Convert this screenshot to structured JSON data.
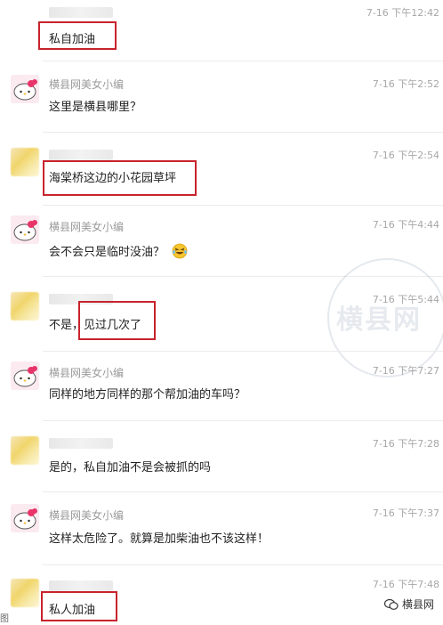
{
  "messages": [
    {
      "sender": "",
      "time": "7-16 下午12:42",
      "text": "私自加油",
      "avatar": "blurred"
    },
    {
      "sender": "横县网美女小编",
      "time": "7-16 下午2:52",
      "text": "这里是横县哪里？",
      "avatar": "kitty"
    },
    {
      "sender": "",
      "time": "7-16 下午2:54",
      "text": "海棠桥这边的小花园草坪",
      "avatar": "blurred"
    },
    {
      "sender": "横县网美女小编",
      "time": "7-16 下午4:44",
      "text": "会不会只是临时没油？",
      "avatar": "kitty",
      "emoji": "laughing-crying-emoji"
    },
    {
      "sender": "",
      "time": "7-16 下午5:44",
      "text_a": "不是，",
      "text_b": "见过几次了",
      "avatar": "blurred"
    },
    {
      "sender": "横县网美女小编",
      "time": "7-16 下午7:27",
      "text": "同样的地方同样的那个帮加油的车吗？",
      "avatar": "kitty"
    },
    {
      "sender": "",
      "time": "7-16 下午7:28",
      "text": "是的，私自加油不是会被抓的吗",
      "avatar": "blurred"
    },
    {
      "sender": "横县网美女小编",
      "time": "7-16 下午7:37",
      "text": "这样太危险了。就算是加柴油也不该这样！",
      "avatar": "kitty"
    },
    {
      "sender": "",
      "time": "7-16 下午7:48",
      "text": "私人加油",
      "avatar": "blurred"
    }
  ],
  "watermark": {
    "main": "横县网"
  },
  "brand": {
    "name": "横县网"
  },
  "bottom_left": "图",
  "colors": {
    "highlight": "#c8232c",
    "time": "#a7a7a7",
    "sender": "#9a9a9a"
  }
}
